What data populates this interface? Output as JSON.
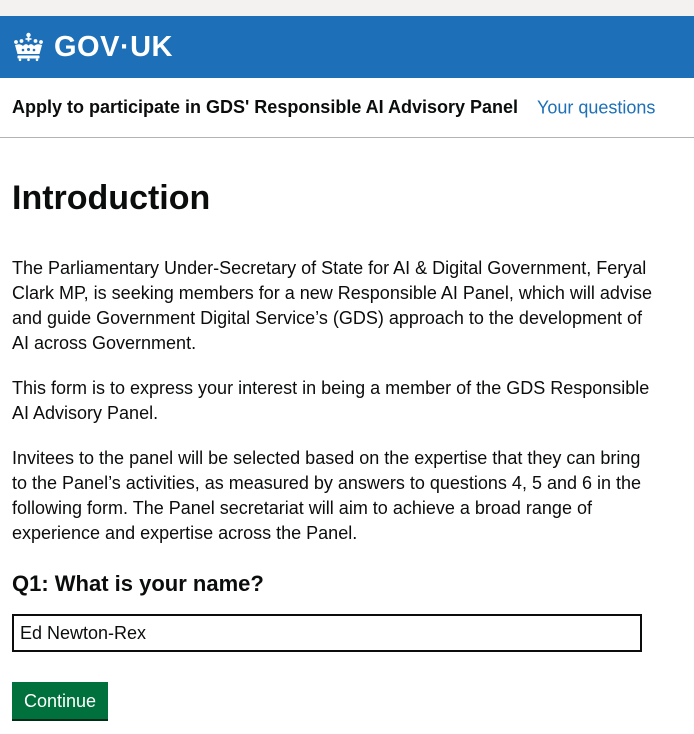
{
  "header": {
    "logo_text": "GOV·UK",
    "logo_icon": "crown-icon"
  },
  "service": {
    "name": "Apply to participate in GDS' Responsible AI Advisory Panel",
    "nav_link": "Your questions"
  },
  "main": {
    "title": "Introduction",
    "paragraphs": [
      "The Parliamentary Under-Secretary of State for AI & Digital Government, Feryal Clark MP, is seeking members for a new Responsible AI Panel, which will advise and guide Government Digital Service’s (GDS) approach to the development of AI across Government.",
      "This form is to express your interest in being a member of the GDS Responsible AI Advisory Panel.",
      "Invitees to the panel will be selected based on the expertise that they can bring to the Panel’s activities, as measured by answers to questions 4, 5 and 6 in the following form. The Panel secretariat will aim to achieve a broad range of experience and expertise across the Panel."
    ],
    "question": {
      "label": "Q1: What is your name?",
      "value": "Ed Newton-Rex"
    },
    "continue_label": "Continue"
  },
  "colors": {
    "header_blue": "#1d70b8",
    "link_blue": "#1d70b8",
    "button_green": "#00703c",
    "text": "#0b0c0c",
    "top_strip": "#f3f2f1"
  }
}
